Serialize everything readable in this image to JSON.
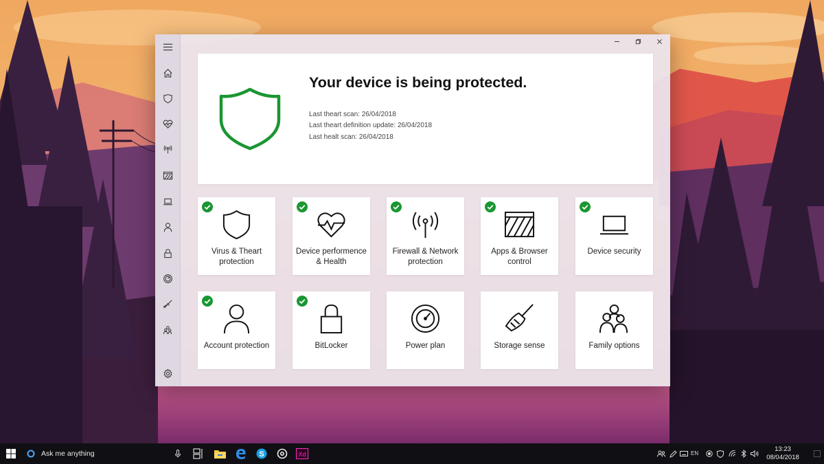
{
  "window": {
    "controls": [
      "minimize-icon",
      "restore-icon",
      "close-icon"
    ]
  },
  "sidebar": {
    "items": [
      {
        "icon": "hamburger-menu-icon"
      },
      {
        "icon": "home-icon"
      },
      {
        "icon": "shield-icon"
      },
      {
        "icon": "heart-pulse-icon"
      },
      {
        "icon": "antenna-icon"
      },
      {
        "icon": "browser-icon"
      },
      {
        "icon": "laptop-icon"
      },
      {
        "icon": "person-icon"
      },
      {
        "icon": "lock-icon"
      },
      {
        "icon": "gauge-icon"
      },
      {
        "icon": "broom-icon"
      },
      {
        "icon": "family-icon"
      },
      {
        "icon": "gear-icon"
      }
    ]
  },
  "hero": {
    "title": "Your device is being protected.",
    "status_color": "#1a9632",
    "lines": [
      "Last theart scan: 26/04/2018",
      "Last theart definition update: 26/04/2018",
      "Last healt scan: 26/04/2018"
    ]
  },
  "tiles": [
    {
      "label": "Virus & Theart\nprotection",
      "icon": "shield-icon",
      "checked": true
    },
    {
      "label": "Device performence\n& Health",
      "icon": "heart-pulse-icon",
      "checked": true
    },
    {
      "label": "Firewall & Network\nprotection",
      "icon": "antenna-icon",
      "checked": true
    },
    {
      "label": "Apps & Browser\ncontrol",
      "icon": "browser-icon",
      "checked": true
    },
    {
      "label": "Device security",
      "icon": "laptop-icon",
      "checked": true
    },
    {
      "label": "Account protection",
      "icon": "person-icon",
      "checked": true
    },
    {
      "label": "BitLocker",
      "icon": "lock-icon",
      "checked": true
    },
    {
      "label": "Power plan",
      "icon": "gauge-icon",
      "checked": false
    },
    {
      "label": "Storage sense",
      "icon": "broom-icon",
      "checked": false
    },
    {
      "label": "Family options",
      "icon": "family-icon",
      "checked": false
    }
  ],
  "taskbar": {
    "search_text": "Ask me anything",
    "language": "EN",
    "time": "13:23",
    "date": "08/04/2018",
    "apps": [
      "microphone-icon",
      "task-view-icon",
      "file-explorer-icon",
      "edge-icon",
      "skype-icon",
      "groove-icon",
      "adobe-xd-icon"
    ],
    "tray": [
      "people-icon",
      "pen-icon",
      "keyboard-icon",
      "record-icon",
      "defender-icon",
      "wifi-icon",
      "bluetooth-icon",
      "volume-icon"
    ]
  },
  "colors": {
    "check_green": "#1a9632",
    "window_bg": "#ece6f0",
    "taskbar_bg": "#101014",
    "xd_pink": "#ff2bc2"
  }
}
